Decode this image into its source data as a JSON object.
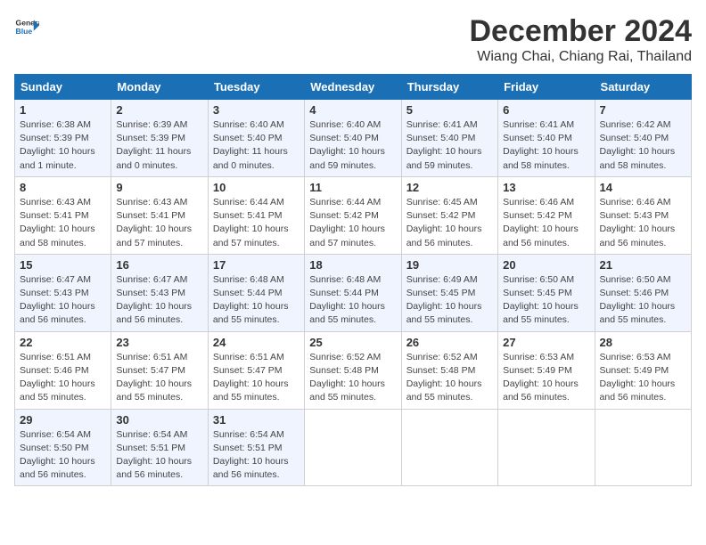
{
  "header": {
    "logo_line1": "General",
    "logo_line2": "Blue",
    "month": "December 2024",
    "location": "Wiang Chai, Chiang Rai, Thailand"
  },
  "weekdays": [
    "Sunday",
    "Monday",
    "Tuesday",
    "Wednesday",
    "Thursday",
    "Friday",
    "Saturday"
  ],
  "weeks": [
    [
      {
        "day": "1",
        "sunrise": "6:38 AM",
        "sunset": "5:39 PM",
        "daylight": "10 hours and 1 minute."
      },
      {
        "day": "2",
        "sunrise": "6:39 AM",
        "sunset": "5:39 PM",
        "daylight": "11 hours and 0 minutes."
      },
      {
        "day": "3",
        "sunrise": "6:40 AM",
        "sunset": "5:40 PM",
        "daylight": "11 hours and 0 minutes."
      },
      {
        "day": "4",
        "sunrise": "6:40 AM",
        "sunset": "5:40 PM",
        "daylight": "10 hours and 59 minutes."
      },
      {
        "day": "5",
        "sunrise": "6:41 AM",
        "sunset": "5:40 PM",
        "daylight": "10 hours and 59 minutes."
      },
      {
        "day": "6",
        "sunrise": "6:41 AM",
        "sunset": "5:40 PM",
        "daylight": "10 hours and 58 minutes."
      },
      {
        "day": "7",
        "sunrise": "6:42 AM",
        "sunset": "5:40 PM",
        "daylight": "10 hours and 58 minutes."
      }
    ],
    [
      {
        "day": "8",
        "sunrise": "6:43 AM",
        "sunset": "5:41 PM",
        "daylight": "10 hours and 58 minutes."
      },
      {
        "day": "9",
        "sunrise": "6:43 AM",
        "sunset": "5:41 PM",
        "daylight": "10 hours and 57 minutes."
      },
      {
        "day": "10",
        "sunrise": "6:44 AM",
        "sunset": "5:41 PM",
        "daylight": "10 hours and 57 minutes."
      },
      {
        "day": "11",
        "sunrise": "6:44 AM",
        "sunset": "5:42 PM",
        "daylight": "10 hours and 57 minutes."
      },
      {
        "day": "12",
        "sunrise": "6:45 AM",
        "sunset": "5:42 PM",
        "daylight": "10 hours and 56 minutes."
      },
      {
        "day": "13",
        "sunrise": "6:46 AM",
        "sunset": "5:42 PM",
        "daylight": "10 hours and 56 minutes."
      },
      {
        "day": "14",
        "sunrise": "6:46 AM",
        "sunset": "5:43 PM",
        "daylight": "10 hours and 56 minutes."
      }
    ],
    [
      {
        "day": "15",
        "sunrise": "6:47 AM",
        "sunset": "5:43 PM",
        "daylight": "10 hours and 56 minutes."
      },
      {
        "day": "16",
        "sunrise": "6:47 AM",
        "sunset": "5:43 PM",
        "daylight": "10 hours and 56 minutes."
      },
      {
        "day": "17",
        "sunrise": "6:48 AM",
        "sunset": "5:44 PM",
        "daylight": "10 hours and 55 minutes."
      },
      {
        "day": "18",
        "sunrise": "6:48 AM",
        "sunset": "5:44 PM",
        "daylight": "10 hours and 55 minutes."
      },
      {
        "day": "19",
        "sunrise": "6:49 AM",
        "sunset": "5:45 PM",
        "daylight": "10 hours and 55 minutes."
      },
      {
        "day": "20",
        "sunrise": "6:50 AM",
        "sunset": "5:45 PM",
        "daylight": "10 hours and 55 minutes."
      },
      {
        "day": "21",
        "sunrise": "6:50 AM",
        "sunset": "5:46 PM",
        "daylight": "10 hours and 55 minutes."
      }
    ],
    [
      {
        "day": "22",
        "sunrise": "6:51 AM",
        "sunset": "5:46 PM",
        "daylight": "10 hours and 55 minutes."
      },
      {
        "day": "23",
        "sunrise": "6:51 AM",
        "sunset": "5:47 PM",
        "daylight": "10 hours and 55 minutes."
      },
      {
        "day": "24",
        "sunrise": "6:51 AM",
        "sunset": "5:47 PM",
        "daylight": "10 hours and 55 minutes."
      },
      {
        "day": "25",
        "sunrise": "6:52 AM",
        "sunset": "5:48 PM",
        "daylight": "10 hours and 55 minutes."
      },
      {
        "day": "26",
        "sunrise": "6:52 AM",
        "sunset": "5:48 PM",
        "daylight": "10 hours and 55 minutes."
      },
      {
        "day": "27",
        "sunrise": "6:53 AM",
        "sunset": "5:49 PM",
        "daylight": "10 hours and 56 minutes."
      },
      {
        "day": "28",
        "sunrise": "6:53 AM",
        "sunset": "5:49 PM",
        "daylight": "10 hours and 56 minutes."
      }
    ],
    [
      {
        "day": "29",
        "sunrise": "6:54 AM",
        "sunset": "5:50 PM",
        "daylight": "10 hours and 56 minutes."
      },
      {
        "day": "30",
        "sunrise": "6:54 AM",
        "sunset": "5:51 PM",
        "daylight": "10 hours and 56 minutes."
      },
      {
        "day": "31",
        "sunrise": "6:54 AM",
        "sunset": "5:51 PM",
        "daylight": "10 hours and 56 minutes."
      },
      null,
      null,
      null,
      null
    ]
  ],
  "daylight_label": "Daylight:",
  "sunrise_label": "Sunrise:",
  "sunset_label": "Sunset:"
}
